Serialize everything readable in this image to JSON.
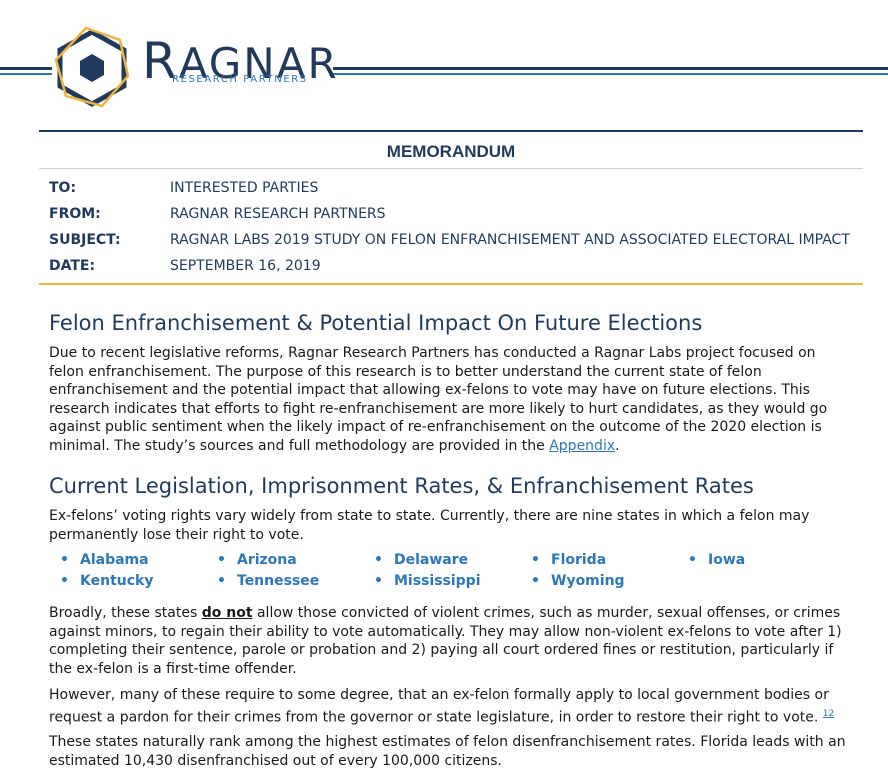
{
  "brand": {
    "name_first": "R",
    "name_rest": "AGNAR",
    "subtitle": "RESEARCH PARTNERS",
    "colors": {
      "navy": "#1f3a5c",
      "blue": "#2a78b8",
      "gold": "#f0b43c"
    },
    "logo_icon": "hexagon-logo-icon"
  },
  "memo": {
    "title": "MEMORANDUM",
    "rows": [
      {
        "key": "TO:",
        "value": "INTERESTED PARTIES"
      },
      {
        "key": "FROM:",
        "value": "RAGNAR RESEARCH PARTNERS"
      },
      {
        "key": "SUBJECT:",
        "value": "RAGNAR LABS 2019 STUDY ON FELON ENFRANCHISEMENT AND ASSOCIATED ELECTORAL IMPACT"
      },
      {
        "key": "DATE:",
        "value": "SEPTEMBER 16, 2019"
      }
    ]
  },
  "section1": {
    "heading": "Felon Enfranchisement & Potential Impact On Future Elections",
    "body": "Due to recent legislative reforms, Ragnar Research Partners has conducted a Ragnar Labs project focused on felon enfranchisement. The purpose of this research is to better understand the current state of felon enfranchisement and the potential impact that allowing ex-felons to vote may have on future elections. This research indicates that efforts to fight re-enfranchisement are more likely to hurt candidates, as they would go against public sentiment when the likely impact of re-enfranchisement on the outcome of the 2020 election is minimal. The study’s sources and full methodology are provided in the",
    "link": "Appendix",
    "after_link": "."
  },
  "section2": {
    "heading": "Current Legislation, Imprisonment Rates, & Enfranchisement Rates",
    "intro": "Ex-felons’ voting rights vary widely from state to state. Currently, there are nine states in which a felon may permanently lose their right to vote.",
    "bullet": "•",
    "states": [
      "Alabama",
      "Arizona",
      "Delaware",
      "Florida",
      "Iowa",
      "Kentucky",
      "Tennessee",
      "Mississippi",
      "Wyoming"
    ],
    "para2_before": "Broadly, these states",
    "para2_emph": "do not",
    "para2_after": "allow those convicted of violent crimes, such as murder, sexual offenses, or crimes against minors, to regain their ability to vote automatically. They may allow non-violent ex-felons to vote after 1) completing their sentence, parole or probation and 2) paying all court ordered fines or restitution, particularly if the ex-felon is a first-time offender.",
    "para3": "However, many of these require to some degree, that an ex-felon formally apply to local government bodies or request a pardon for their crimes from the governor or state legislature, in order to restore their right to vote.",
    "footnote1": "1",
    "footnote2": "2",
    "para4": "These states naturally rank among the highest estimates of felon disenfranchisement rates. Florida leads with an estimated 10,430 disenfranchised out of every 100,000 citizens."
  }
}
